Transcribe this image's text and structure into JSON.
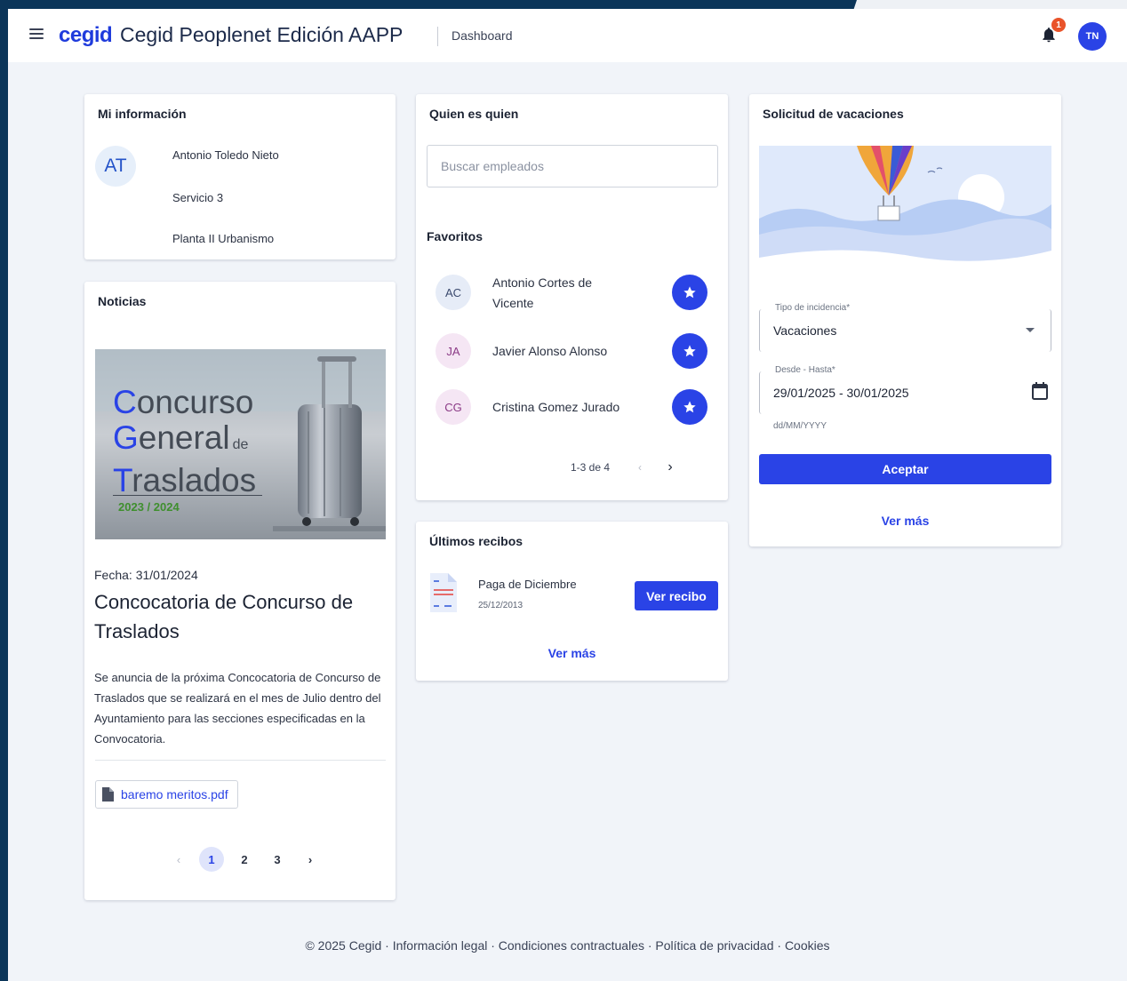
{
  "header": {
    "brand": "cegid",
    "app_title": "Cegid Peoplenet Edición AAPP",
    "breadcrumb": "Dashboard",
    "notification_count": "1",
    "user_initials": "TN"
  },
  "mi_informacion": {
    "title": "Mi información",
    "initials": "AT",
    "name": "Antonio Toledo Nieto",
    "service": "Servicio 3",
    "location": "Planta II Urbanismo"
  },
  "noticias": {
    "title": "Noticias",
    "image_text": {
      "line1_cap": "C",
      "line1_rest": "oncurso",
      "line2_cap": "G",
      "line2_rest": "eneral",
      "de": "de",
      "line3_cap": "T",
      "line3_rest": "raslados",
      "years": "2023 / 2024"
    },
    "date": "Fecha: 31/01/2024",
    "headline": "Concocatoria de Concurso de Traslados",
    "body": "Se anuncia de la próxima Concocatoria de Concurso de Traslados que se realizará en el mes de Julio dentro del Ayuntamiento para las secciones especificadas en la Convocatoria.",
    "attachment": "baremo meritos.pdf",
    "pages": [
      "1",
      "2",
      "3"
    ],
    "active_page": "1"
  },
  "quien_es_quien": {
    "title": "Quien es quien",
    "search_placeholder": "Buscar empleados",
    "favorites_title": "Favoritos",
    "favorites": [
      {
        "initials": "AC",
        "name": "Antonio Cortes de Vicente"
      },
      {
        "initials": "JA",
        "name": "Javier Alonso Alonso"
      },
      {
        "initials": "CG",
        "name": "Cristina Gomez Jurado"
      }
    ],
    "pagination": "1-3 de 4"
  },
  "ultimos_recibos": {
    "title": "Últimos recibos",
    "receipt_name": "Paga de Diciembre",
    "receipt_date": "25/12/2013",
    "button": "Ver recibo",
    "more": "Ver más"
  },
  "vacaciones": {
    "title": "Solicitud de vacaciones",
    "type_label": "Tipo de incidencia*",
    "type_value": "Vacaciones",
    "range_label": "Desde - Hasta*",
    "range_value": "29/01/2025 - 30/01/2025",
    "range_hint": "dd/MM/YYYY",
    "accept": "Aceptar",
    "more": "Ver más"
  },
  "footer": {
    "text": "© 2025 Cegid · Información legal · Condiciones contractuales · Política de privacidad · Cookies"
  },
  "colors": {
    "primary": "#2a43e6",
    "frame": "#0b3559",
    "background": "#f1f4f9",
    "badge": "#e9532a"
  },
  "icons": [
    "menu-icon",
    "bell-icon",
    "star-icon",
    "chevron-left-icon",
    "chevron-right-icon",
    "file-icon",
    "calendar-icon",
    "dropdown-arrow-icon",
    "receipt-document-icon"
  ]
}
